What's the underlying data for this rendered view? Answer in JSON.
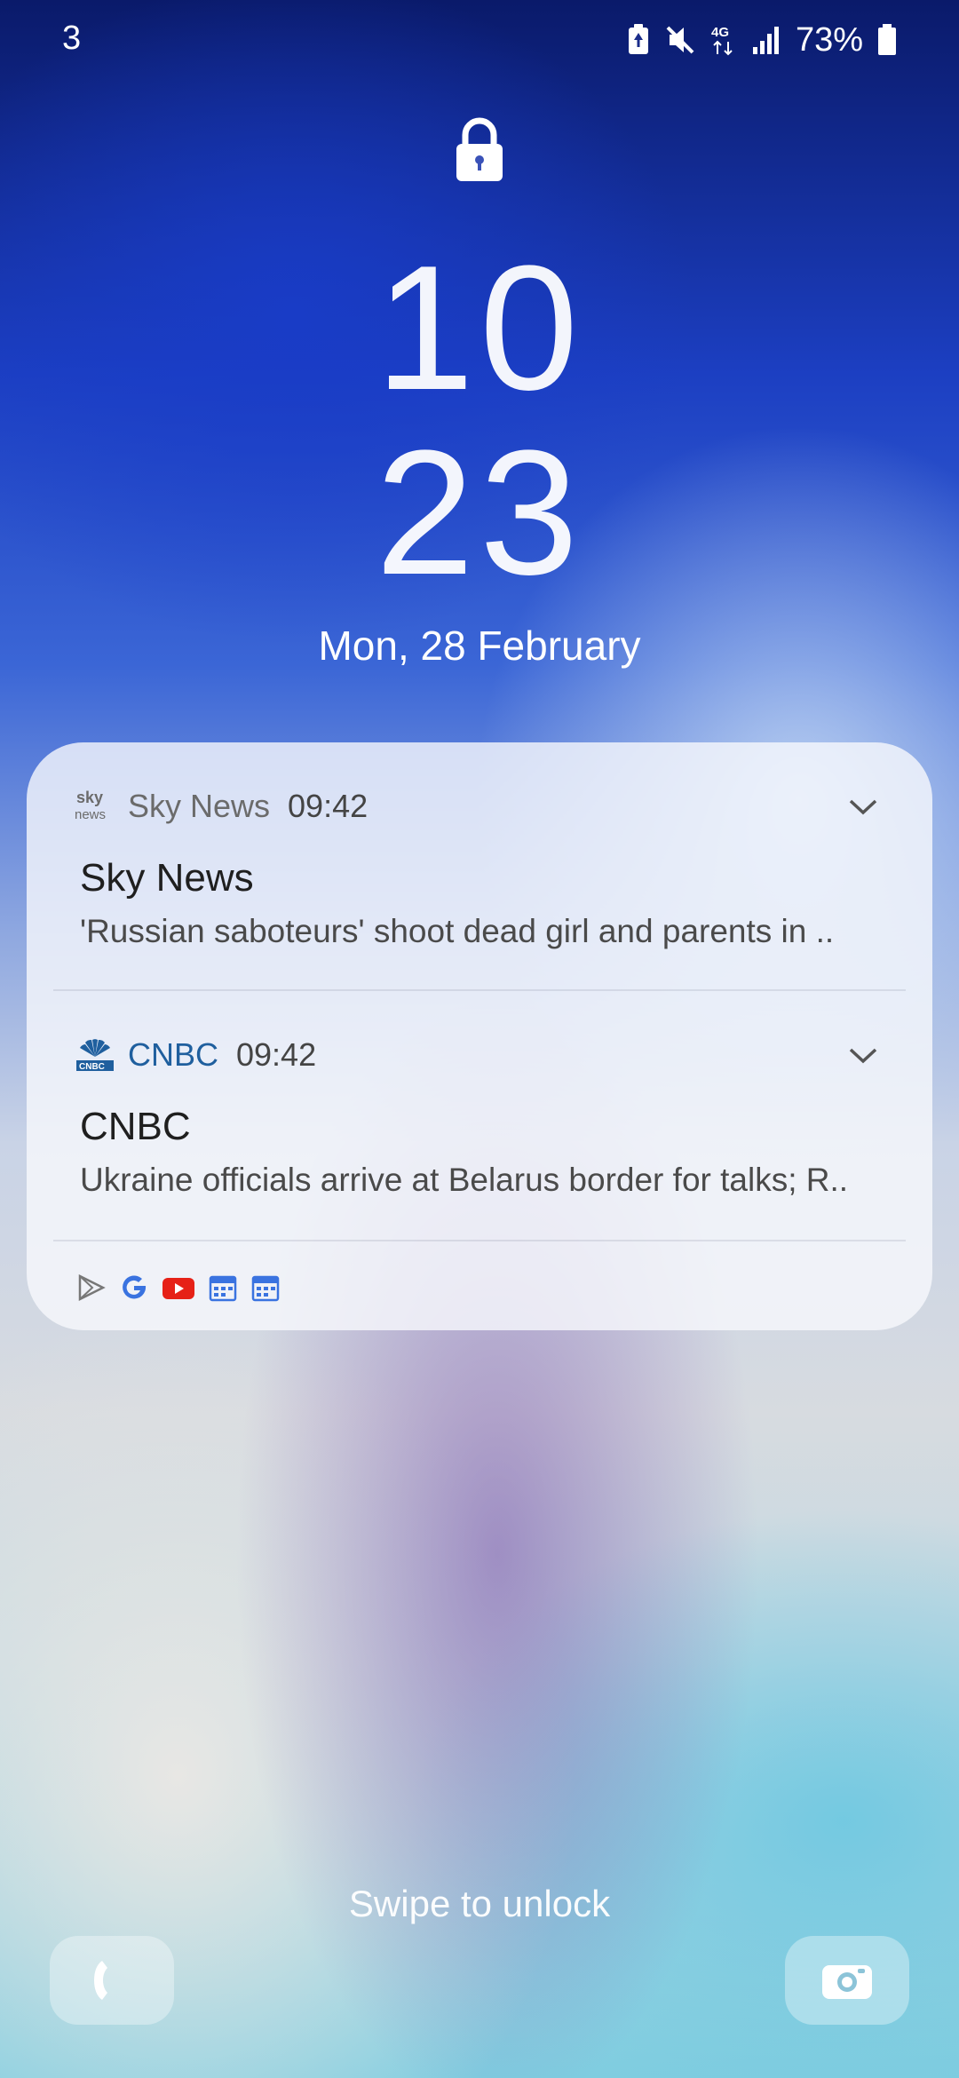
{
  "status_bar": {
    "notification_count": "3",
    "network": "4G",
    "battery_percent": "73%"
  },
  "lock_screen": {
    "clock_hours": "10",
    "clock_minutes": "23",
    "date": "Mon, 28 February",
    "swipe_hint": "Swipe to unlock"
  },
  "notifications": [
    {
      "app_name": "Sky News",
      "time": "09:42",
      "title": "Sky News",
      "body": "'Russian saboteurs' shoot dead girl and parents in ..",
      "app_color": "#6b6b6b"
    },
    {
      "app_name": "CNBC",
      "time": "09:42",
      "title": "CNBC",
      "body": "Ukraine officials arrive at Belarus border for talks; R..",
      "app_color": "#1f5f9e"
    }
  ],
  "app_tray_icons": [
    "play-store-icon",
    "google-icon",
    "youtube-icon",
    "calendar-icon",
    "calendar-icon"
  ],
  "sky_logo_text": "sky news",
  "colors": {
    "card_background": "#f8f9fc",
    "cnbc_blue": "#1f5f9e",
    "youtube_red": "#e62117"
  }
}
